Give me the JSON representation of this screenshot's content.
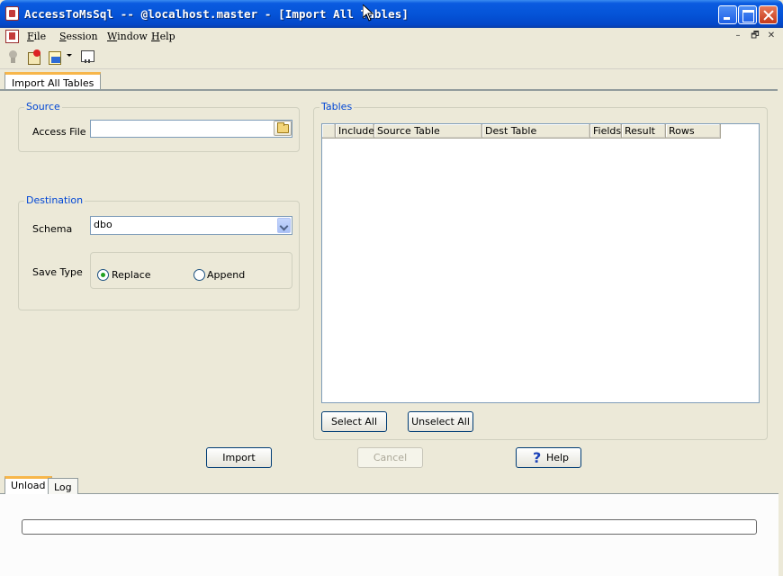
{
  "window": {
    "title": "AccessToMsSql -- @localhost.master - [Import All Tables]"
  },
  "menu": {
    "items": [
      "File",
      "Session",
      "Window",
      "Help"
    ],
    "mdi_controls": [
      "–",
      "🗗",
      "✕"
    ]
  },
  "document_tab": "Import All Tables",
  "source": {
    "group_title": "Source",
    "access_file_label": "Access File",
    "access_file_value": ""
  },
  "destination": {
    "group_title": "Destination",
    "schema_label": "Schema",
    "schema_value": "dbo",
    "save_type_label": "Save Type",
    "replace_label": "Replace",
    "append_label": "Append",
    "selected": "Replace"
  },
  "tables": {
    "group_title": "Tables",
    "columns": [
      "",
      "Include",
      "Source Table",
      "Dest Table",
      "Fields",
      "Result",
      "Rows"
    ],
    "select_all": "Select All",
    "unselect_all": "Unselect All"
  },
  "actions": {
    "import": "Import",
    "cancel": "Cancel",
    "help": "Help"
  },
  "bottom_tabs": [
    "Unload",
    "Log"
  ],
  "progress": {
    "value": 0
  }
}
